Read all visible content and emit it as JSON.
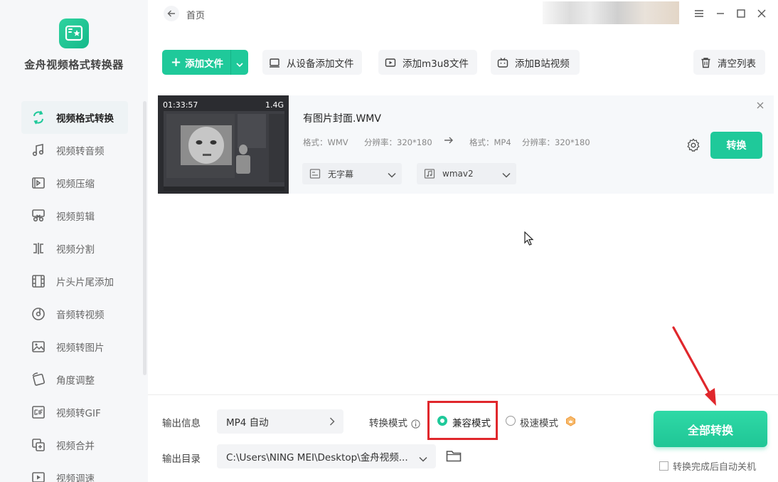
{
  "app": {
    "name": "金舟视频格式转换器"
  },
  "header": {
    "breadcrumb": "首页"
  },
  "sidebar": {
    "items": [
      {
        "label": "视频格式转换",
        "icon": "video-convert-icon",
        "active": true
      },
      {
        "label": "视频转音频",
        "icon": "music-note-icon"
      },
      {
        "label": "视频压缩",
        "icon": "compress-icon"
      },
      {
        "label": "视频剪辑",
        "icon": "scissors-icon"
      },
      {
        "label": "视频分割",
        "icon": "split-icon"
      },
      {
        "label": "片头片尾添加",
        "icon": "film-strip-icon"
      },
      {
        "label": "音频转视频",
        "icon": "music-disc-icon"
      },
      {
        "label": "视频转图片",
        "icon": "image-icon"
      },
      {
        "label": "角度调整",
        "icon": "rotate-icon"
      },
      {
        "label": "视频转GIF",
        "icon": "gif-icon"
      },
      {
        "label": "视频合并",
        "icon": "merge-icon"
      },
      {
        "label": "视频调速",
        "icon": "speed-icon"
      }
    ]
  },
  "toolbar": {
    "add_file": "添加文件",
    "add_from_device": "从设备添加文件",
    "add_m3u8": "添加m3u8文件",
    "add_bilibili": "添加B站视频",
    "clear_list": "清空列表"
  },
  "file": {
    "duration": "01:33:57",
    "size": "1.4G",
    "name": "有图片封面.WMV",
    "src_format": "格式：WMV",
    "src_resolution": "分辨率：320*180",
    "dst_format": "格式：MP4",
    "dst_resolution": "分辨率：320*180",
    "subtitle": "无字幕",
    "audio": "wmav2",
    "convert_label": "转换"
  },
  "bottom": {
    "output_info_label": "输出信息",
    "output_info_value": "MP4 自动",
    "mode_label": "转换模式",
    "mode_compatible": "兼容模式",
    "mode_fast": "极速模式",
    "output_dir_label": "输出目录",
    "output_dir_value": "C:\\Users\\NING MEI\\Desktop\\金舟视频...",
    "convert_all": "全部转换",
    "auto_shutdown": "转换完成后自动关机"
  },
  "colors": {
    "accent": "#1fc99a",
    "highlight": "#e0272c",
    "premium": "#f0a040"
  }
}
